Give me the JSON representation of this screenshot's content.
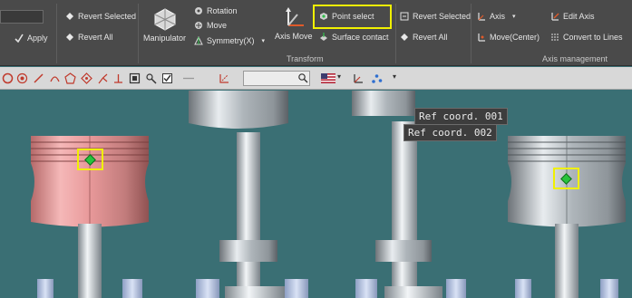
{
  "ribbon": {
    "input_value": "",
    "apply_label": "Apply",
    "revert_selected_1": "Revert Selected",
    "revert_all_1": "Revert All",
    "manipulator_label": "Manipulator",
    "rotation_label": "Rotation",
    "move_label": "Move",
    "symmetry_label": "Symmetry(X)",
    "axis_move_label": "Axis Move",
    "point_select_label": "Point select",
    "surface_contact_label": "Surface contact",
    "revert_selected_2": "Revert Selected",
    "revert_all_2": "Revert All",
    "axis_label": "Axis",
    "move_center_label": "Move(Center)",
    "edit_axis_label": "Edit Axis",
    "convert_lines_label": "Convert to Lines",
    "group_transform": "Transform",
    "group_axis_management": "Axis management"
  },
  "viewport": {
    "tooltip_1": "Ref coord. 001",
    "tooltip_2": "Ref coord. 002"
  },
  "colors": {
    "highlight": "#f0f000",
    "point_marker": "#27c33c",
    "background": "#3a6f74",
    "ribbon": "#4a4a4a"
  }
}
